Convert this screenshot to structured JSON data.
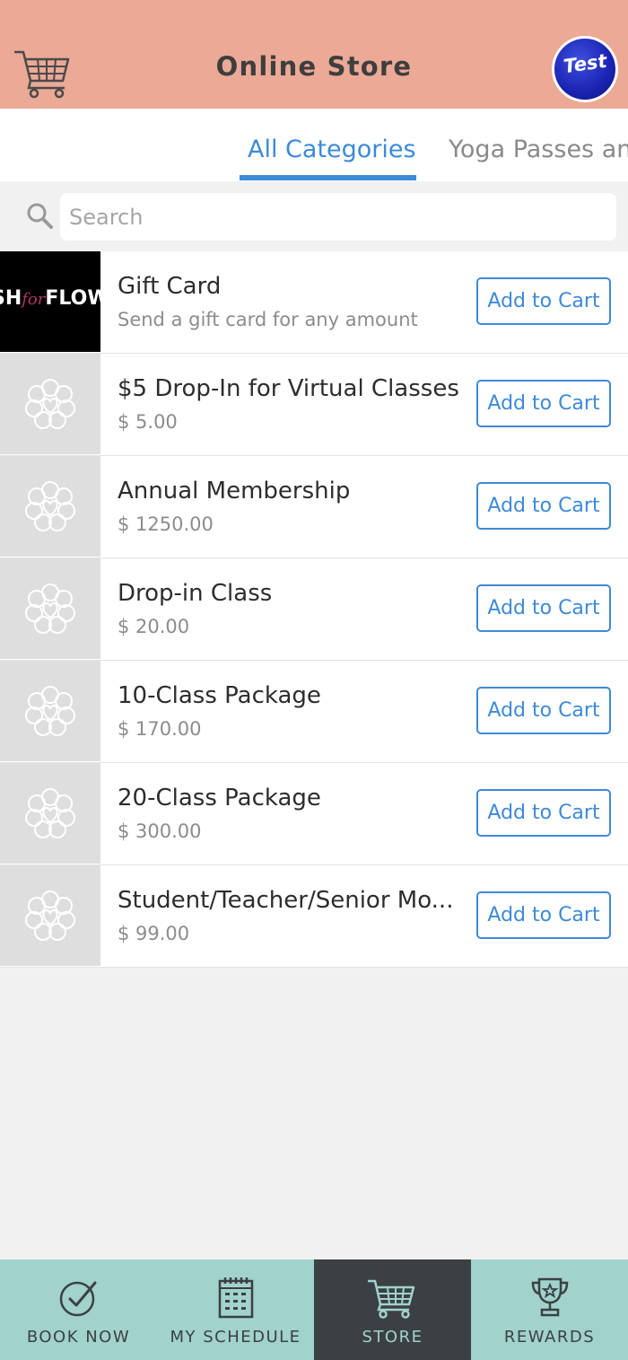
{
  "header": {
    "title": "Online Store",
    "avatar_text": "Test",
    "cart_icon": "shopping-cart-icon"
  },
  "tabs": [
    {
      "label": "All Categories",
      "active": true
    },
    {
      "label": "Yoga Passes an",
      "active": false
    }
  ],
  "search": {
    "placeholder": "Search",
    "value": "",
    "icon": "search-icon"
  },
  "products": [
    {
      "title": "Gift Card",
      "subtitle": "Send a gift card for any amount",
      "thumb_text_a": "SH",
      "thumb_text_b": "for",
      "thumb_text_c": "FLOW",
      "button": "Add to Cart"
    },
    {
      "title": "$5 Drop-In for Virtual Classes",
      "subtitle": "$ 5.00",
      "button": "Add to Cart"
    },
    {
      "title": "Annual Membership",
      "subtitle": "$ 1250.00",
      "button": "Add to Cart"
    },
    {
      "title": "Drop-in Class",
      "subtitle": "$ 20.00",
      "button": "Add to Cart"
    },
    {
      "title": "10-Class Package",
      "subtitle": "$ 170.00",
      "button": "Add to Cart"
    },
    {
      "title": "20-Class Package",
      "subtitle": "$ 300.00",
      "button": "Add to Cart"
    },
    {
      "title": "Student/Teacher/Senior Mo...",
      "subtitle": "$ 99.00",
      "button": "Add to Cart"
    }
  ],
  "bottom_nav": [
    {
      "label": "BOOK NOW",
      "icon": "check-circle-icon",
      "active": false
    },
    {
      "label": "MY SCHEDULE",
      "icon": "calendar-icon",
      "active": false
    },
    {
      "label": "STORE",
      "icon": "cart-icon",
      "active": true
    },
    {
      "label": "REWARDS",
      "icon": "trophy-icon",
      "active": false
    }
  ],
  "colors": {
    "header_bg": "#eba996",
    "accent": "#3d8ad8",
    "nav_bg": "#a1d2cc",
    "nav_active_bg": "#3b4043"
  }
}
